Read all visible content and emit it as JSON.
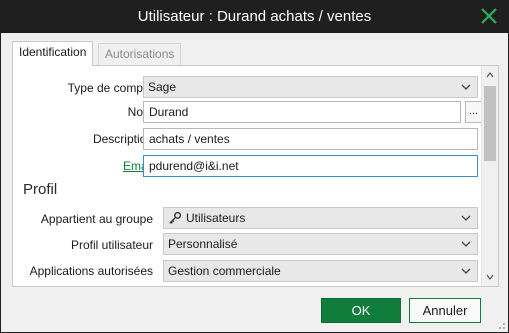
{
  "window": {
    "title": "Utilisateur : Durand achats / ventes"
  },
  "tabs": [
    {
      "label": "Identification",
      "active": true
    },
    {
      "label": "Autorisations",
      "active": false
    }
  ],
  "form": {
    "type_compte": {
      "label": "Type de compte",
      "value": "Sage"
    },
    "nom": {
      "label": "Nom",
      "value": "Durand",
      "browse_label": "..."
    },
    "description": {
      "label": "Description",
      "value": "achats / ventes"
    },
    "email": {
      "label": "Email",
      "value": "pdurend@i&i.net"
    }
  },
  "profil": {
    "heading": "Profil",
    "groupe": {
      "label": "Appartient au groupe",
      "value": "Utilisateurs",
      "icon": "key-icon"
    },
    "profil_utilisateur": {
      "label": "Profil utilisateur",
      "value": "Personnalisé"
    },
    "applications": {
      "label": "Applications autorisées",
      "value": "Gestion commerciale"
    }
  },
  "buttons": {
    "ok": "OK",
    "cancel": "Annuler"
  },
  "colors": {
    "accent": "#117d3d",
    "titlebar": "#1f1f1f",
    "focus": "#3c8cd4"
  }
}
